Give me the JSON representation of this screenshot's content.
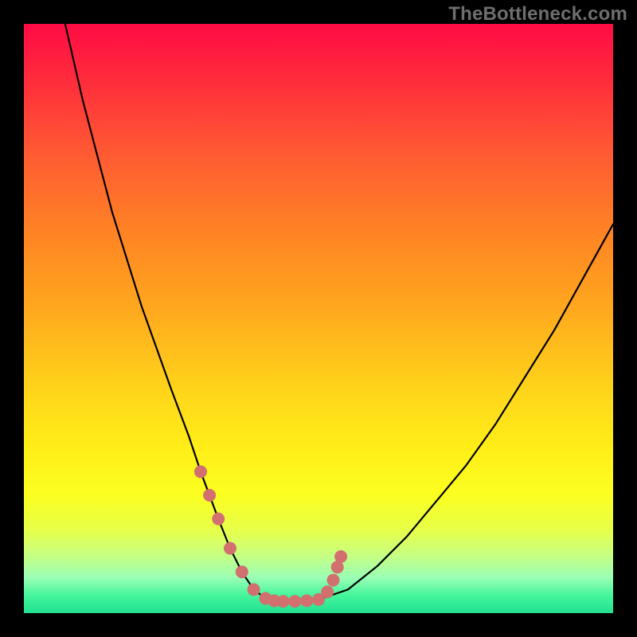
{
  "watermark": "TheBottleneck.com",
  "chart_data": {
    "type": "line",
    "title": "",
    "xlabel": "",
    "ylabel": "",
    "xlim": [
      0,
      100
    ],
    "ylim": [
      0,
      100
    ],
    "series": [
      {
        "name": "bottleneck-curve",
        "x": [
          7,
          10,
          15,
          20,
          25,
          28,
          30,
          33,
          35,
          37,
          39,
          41,
          43,
          45,
          50,
          55,
          60,
          65,
          70,
          75,
          80,
          85,
          90,
          95,
          100
        ],
        "values": [
          100,
          87,
          68,
          52,
          38,
          30,
          24,
          16,
          11,
          7,
          4,
          2.5,
          2,
          2,
          2.3,
          4,
          8,
          13,
          19,
          25,
          32,
          40,
          48,
          57,
          66
        ]
      }
    ],
    "markers": {
      "name": "highlight-points",
      "color": "#d1706e",
      "x": [
        30,
        31.5,
        33,
        35,
        37,
        39,
        41,
        42.5,
        44,
        46,
        48,
        50,
        51.5,
        52.5,
        53.2,
        53.8
      ],
      "values": [
        24,
        20,
        16,
        11,
        7,
        4,
        2.5,
        2.1,
        2,
        2,
        2.1,
        2.3,
        3.6,
        5.6,
        7.8,
        9.6
      ]
    },
    "gradient_stops": [
      {
        "pos": 0,
        "color": "#ff0b44"
      },
      {
        "pos": 10,
        "color": "#ff2e3b"
      },
      {
        "pos": 22,
        "color": "#ff5a33"
      },
      {
        "pos": 35,
        "color": "#ff8224"
      },
      {
        "pos": 48,
        "color": "#ffa71e"
      },
      {
        "pos": 62,
        "color": "#ffd41a"
      },
      {
        "pos": 72,
        "color": "#ffee18"
      },
      {
        "pos": 80,
        "color": "#fbff20"
      },
      {
        "pos": 86,
        "color": "#e6ff4a"
      },
      {
        "pos": 90,
        "color": "#c8ff80"
      },
      {
        "pos": 94,
        "color": "#9affb5"
      },
      {
        "pos": 97,
        "color": "#44f59c"
      },
      {
        "pos": 100,
        "color": "#21e090"
      }
    ]
  }
}
